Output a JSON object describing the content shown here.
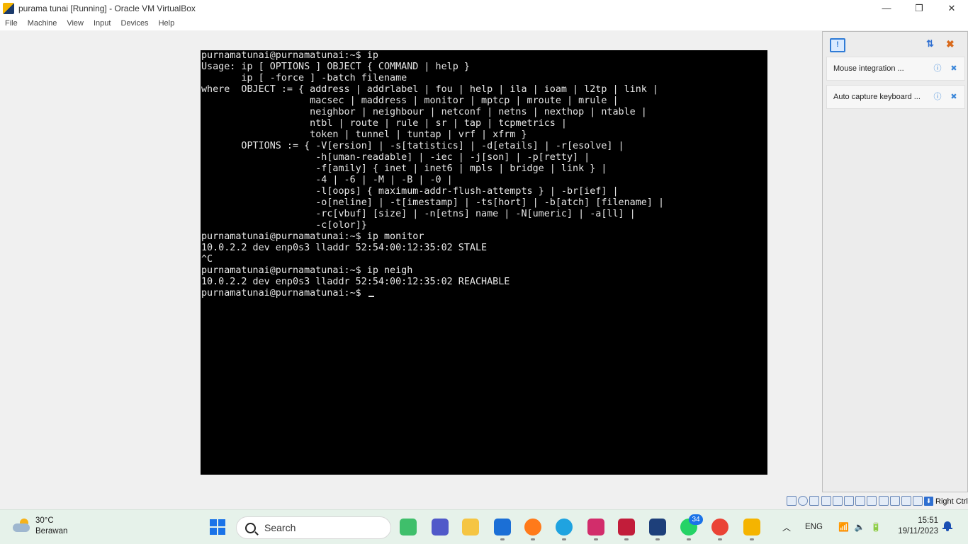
{
  "window": {
    "title": "purama tunai [Running] - Oracle VM VirtualBox",
    "controls": {
      "minimize": "—",
      "restore": "❐",
      "close": "✕"
    }
  },
  "menu": [
    "File",
    "Machine",
    "View",
    "Input",
    "Devices",
    "Help"
  ],
  "terminal": {
    "lines": [
      "purnamatunai@purnamatunai:~$ ip",
      "Usage: ip [ OPTIONS ] OBJECT { COMMAND | help }",
      "       ip [ -force ] -batch filename",
      "where  OBJECT := { address | addrlabel | fou | help | ila | ioam | l2tp | link |",
      "                   macsec | maddress | monitor | mptcp | mroute | mrule |",
      "                   neighbor | neighbour | netconf | netns | nexthop | ntable |",
      "                   ntbl | route | rule | sr | tap | tcpmetrics |",
      "                   token | tunnel | tuntap | vrf | xfrm }",
      "       OPTIONS := { -V[ersion] | -s[tatistics] | -d[etails] | -r[esolve] |",
      "                    -h[uman-readable] | -iec | -j[son] | -p[retty] |",
      "                    -f[amily] { inet | inet6 | mpls | bridge | link } |",
      "                    -4 | -6 | -M | -B | -0 |",
      "                    -l[oops] { maximum-addr-flush-attempts } | -br[ief] |",
      "                    -o[neline] | -t[imestamp] | -ts[hort] | -b[atch] [filename] |",
      "                    -rc[vbuf] [size] | -n[etns] name | -N[umeric] | -a[ll] |",
      "                    -c[olor]}",
      "purnamatunai@purnamatunai:~$ ip monitor",
      "10.0.2.2 dev enp0s3 lladdr 52:54:00:12:35:02 STALE",
      "^C",
      "purnamatunai@purnamatunai:~$ ip neigh",
      "10.0.2.2 dev enp0s3 lladdr 52:54:00:12:35:02 REACHABLE"
    ],
    "prompt": "purnamatunai@purnamatunai:~$ "
  },
  "notifications": {
    "items": [
      {
        "text": "Mouse integration ...",
        "icons": [
          "info-icon",
          "close-icon"
        ]
      },
      {
        "text": "Auto capture keyboard ...",
        "icons": [
          "info-icon",
          "close-icon"
        ]
      }
    ]
  },
  "statusbar": {
    "icon_count": 12,
    "host_key": "Right Ctrl"
  },
  "taskbar": {
    "weather": {
      "temp": "30°C",
      "condition": "Berawan"
    },
    "search_placeholder": "Search",
    "whatsapp_badge": "34",
    "tray": {
      "lang": "ENG",
      "time": "15:51",
      "date": "19/11/2023"
    },
    "app_colors": [
      "#3fbf6b",
      "#5059c9",
      "#f5c542",
      "#1b6fd6",
      "#ff7a1a",
      "#1fa3e0",
      "#d22d6b",
      "#c21d3a",
      "#1d3f7a",
      "#25d366",
      "#ea4335",
      "#f5b400"
    ]
  }
}
